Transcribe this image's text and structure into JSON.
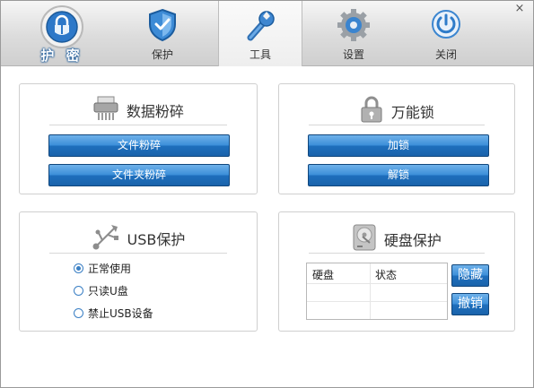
{
  "tabs": [
    {
      "label": "护 密",
      "icon": "lock-shield-icon"
    },
    {
      "label": "保护",
      "icon": "shield-icon"
    },
    {
      "label": "工具",
      "icon": "wrench-icon"
    },
    {
      "label": "设置",
      "icon": "gear-icon"
    },
    {
      "label": "关闭",
      "icon": "power-icon"
    }
  ],
  "active_tab": "工具",
  "close_symbol": "×",
  "shredder": {
    "title": "数据粉碎",
    "icon": "shredder-icon",
    "file_button": "文件粉碎",
    "folder_button": "文件夹粉碎"
  },
  "lock": {
    "title": "万能锁",
    "icon": "padlock-icon",
    "lock_button": "加锁",
    "unlock_button": "解锁"
  },
  "usb": {
    "title": "USB保护",
    "icon": "usb-icon",
    "options": [
      {
        "label": "正常使用",
        "checked": true
      },
      {
        "label": "只读U盘",
        "checked": false
      },
      {
        "label": "禁止USB设备",
        "checked": false
      }
    ]
  },
  "disk": {
    "title": "硬盘保护",
    "icon": "hard-disk-icon",
    "columns": [
      "硬盘",
      "状态"
    ],
    "hide_button": "隐藏",
    "revoke_button": "撤销"
  },
  "colors": {
    "accent": "#2f82cf",
    "button_border": "#10467c",
    "toolbar_bg": "#d8d8d8"
  }
}
